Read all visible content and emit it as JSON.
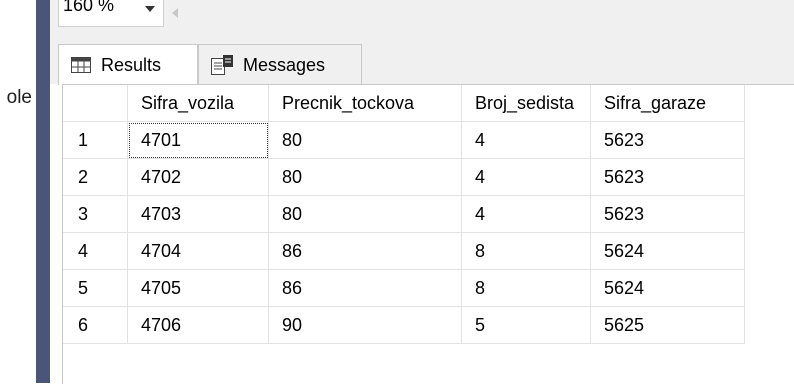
{
  "left_fragment": "ole",
  "zoom": {
    "value": "160 %"
  },
  "tabs": [
    {
      "label": "Results",
      "icon": "grid-icon",
      "active": true
    },
    {
      "label": "Messages",
      "icon": "messages-icon",
      "active": false
    }
  ],
  "grid": {
    "columns": [
      "",
      "Sifra_vozila",
      "Precnik_tockova",
      "Broj_sedista",
      "Sifra_garaze"
    ],
    "rows": [
      [
        "1",
        "4701",
        "80",
        "4",
        "5623"
      ],
      [
        "2",
        "4702",
        "80",
        "4",
        "5623"
      ],
      [
        "3",
        "4703",
        "80",
        "4",
        "5623"
      ],
      [
        "4",
        "4704",
        "86",
        "8",
        "5624"
      ],
      [
        "5",
        "4705",
        "86",
        "8",
        "5624"
      ],
      [
        "6",
        "4706",
        "90",
        "5",
        "5625"
      ]
    ]
  },
  "colors": {
    "splitter": "#4a5578",
    "chrome": "#f0f0f0",
    "grid_line": "#e3e3e3"
  }
}
